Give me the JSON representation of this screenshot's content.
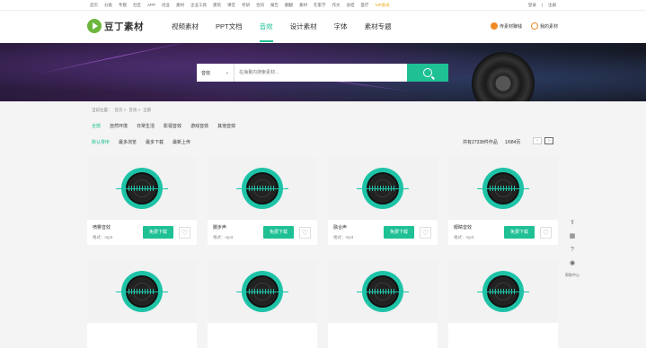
{
  "topbar": {
    "links": [
      "首页",
      "分类",
      "专题",
      "社区",
      "APP",
      "创业",
      "素材",
      "企业工具",
      "建筑",
      "课堂",
      "考研",
      "合同",
      "报告",
      "翻翻",
      "素材",
      "在家学",
      "作文",
      "总结",
      "医疗"
    ],
    "vip": "VIP会员",
    "login": "登录",
    "register": "注册"
  },
  "header": {
    "logo": "豆丁素材",
    "nav": [
      "视频素材",
      "PPT文档",
      "音效",
      "设计素材",
      "字体",
      "素材专题"
    ],
    "active_nav": 2,
    "upload": "传素材赚钱",
    "my": "我的素材"
  },
  "search": {
    "category": "音效",
    "placeholder": "在海量内搜索素材..."
  },
  "breadcrumb": [
    "当前位置：",
    "首页 >",
    "音效 >",
    "全部"
  ],
  "categories": [
    "全部",
    "自然环境",
    "日常生活",
    "影视音效",
    "游戏音效",
    "其他音效"
  ],
  "sorts": [
    "默认排序",
    "最多浏览",
    "最多下载",
    "最新上传"
  ],
  "result": {
    "total": "共有27338件作品",
    "pages": "1/684页"
  },
  "cards": [
    {
      "name": "喷雾音效",
      "format": "格式：mp3"
    },
    {
      "name": "脚步声",
      "format": "格式：mp3"
    },
    {
      "name": "融合声",
      "format": "格式：mp3"
    },
    {
      "name": "眼睛音效",
      "format": "格式：mp3"
    },
    {
      "name": "",
      "format": ""
    },
    {
      "name": "",
      "format": ""
    },
    {
      "name": "",
      "format": ""
    },
    {
      "name": "",
      "format": ""
    }
  ],
  "card_button": "免费下载",
  "sidebar": {
    "help": "帮助中心"
  },
  "colors": {
    "accent": "#1ec094",
    "vip": "#e5a100",
    "upload_icon": "#f08a24"
  }
}
